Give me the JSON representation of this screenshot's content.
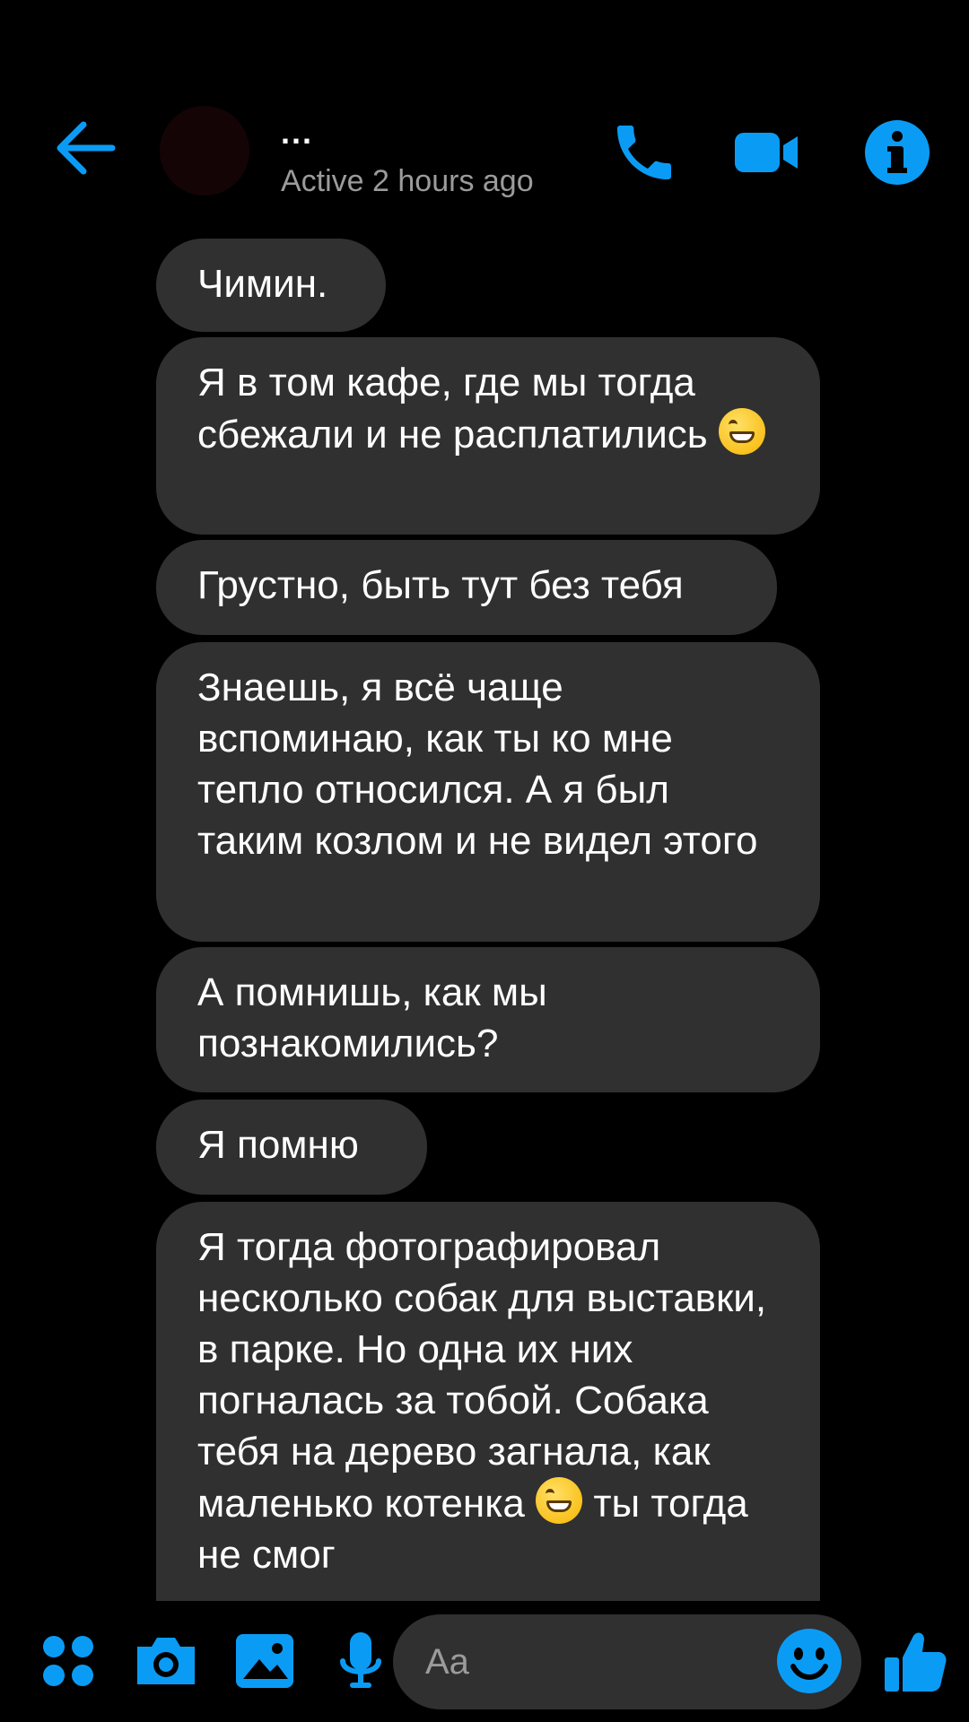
{
  "header": {
    "contact_name": "...",
    "status": "Active 2 hours ago"
  },
  "messages": [
    {
      "text": "Чимин.",
      "emoji_after": false
    },
    {
      "text": "Я в том кафе, где мы тогда сбежали и не расплатились",
      "emoji_after": true
    },
    {
      "text": "Грустно, быть тут без тебя",
      "emoji_after": false
    },
    {
      "text": "Знаешь, я всё чаще вспоминаю, как ты ко мне тепло относился. А я был таким козлом и не видел этого",
      "emoji_after": false
    },
    {
      "text": "А помнишь, как мы познакомились?",
      "emoji_after": false
    },
    {
      "text": "Я помню",
      "emoji_after": false
    },
    {
      "text_before_emoji": "Я тогда фотографировал несколько собак для выставки, в парке. Но одна их них погналась за тобой. Собака тебя на дерево загнала, как маленько котенка",
      "text_after_emoji": "ты тогда не смог",
      "emoji_after": true
    }
  ],
  "composer": {
    "placeholder": "Aa"
  },
  "colors": {
    "accent": "#0a9cf5",
    "bubble": "#303030",
    "background": "#000000",
    "secondary_text": "#9b9b9b",
    "emoji": "#f7b500"
  },
  "icons": {
    "back": "arrow-left-icon",
    "call": "phone-icon",
    "video": "video-camera-icon",
    "info": "info-icon",
    "apps": "four-dots-icon",
    "camera": "camera-icon",
    "gallery": "image-icon",
    "mic": "microphone-icon",
    "emoji": "smiley-icon",
    "like": "thumbs-up-icon"
  }
}
